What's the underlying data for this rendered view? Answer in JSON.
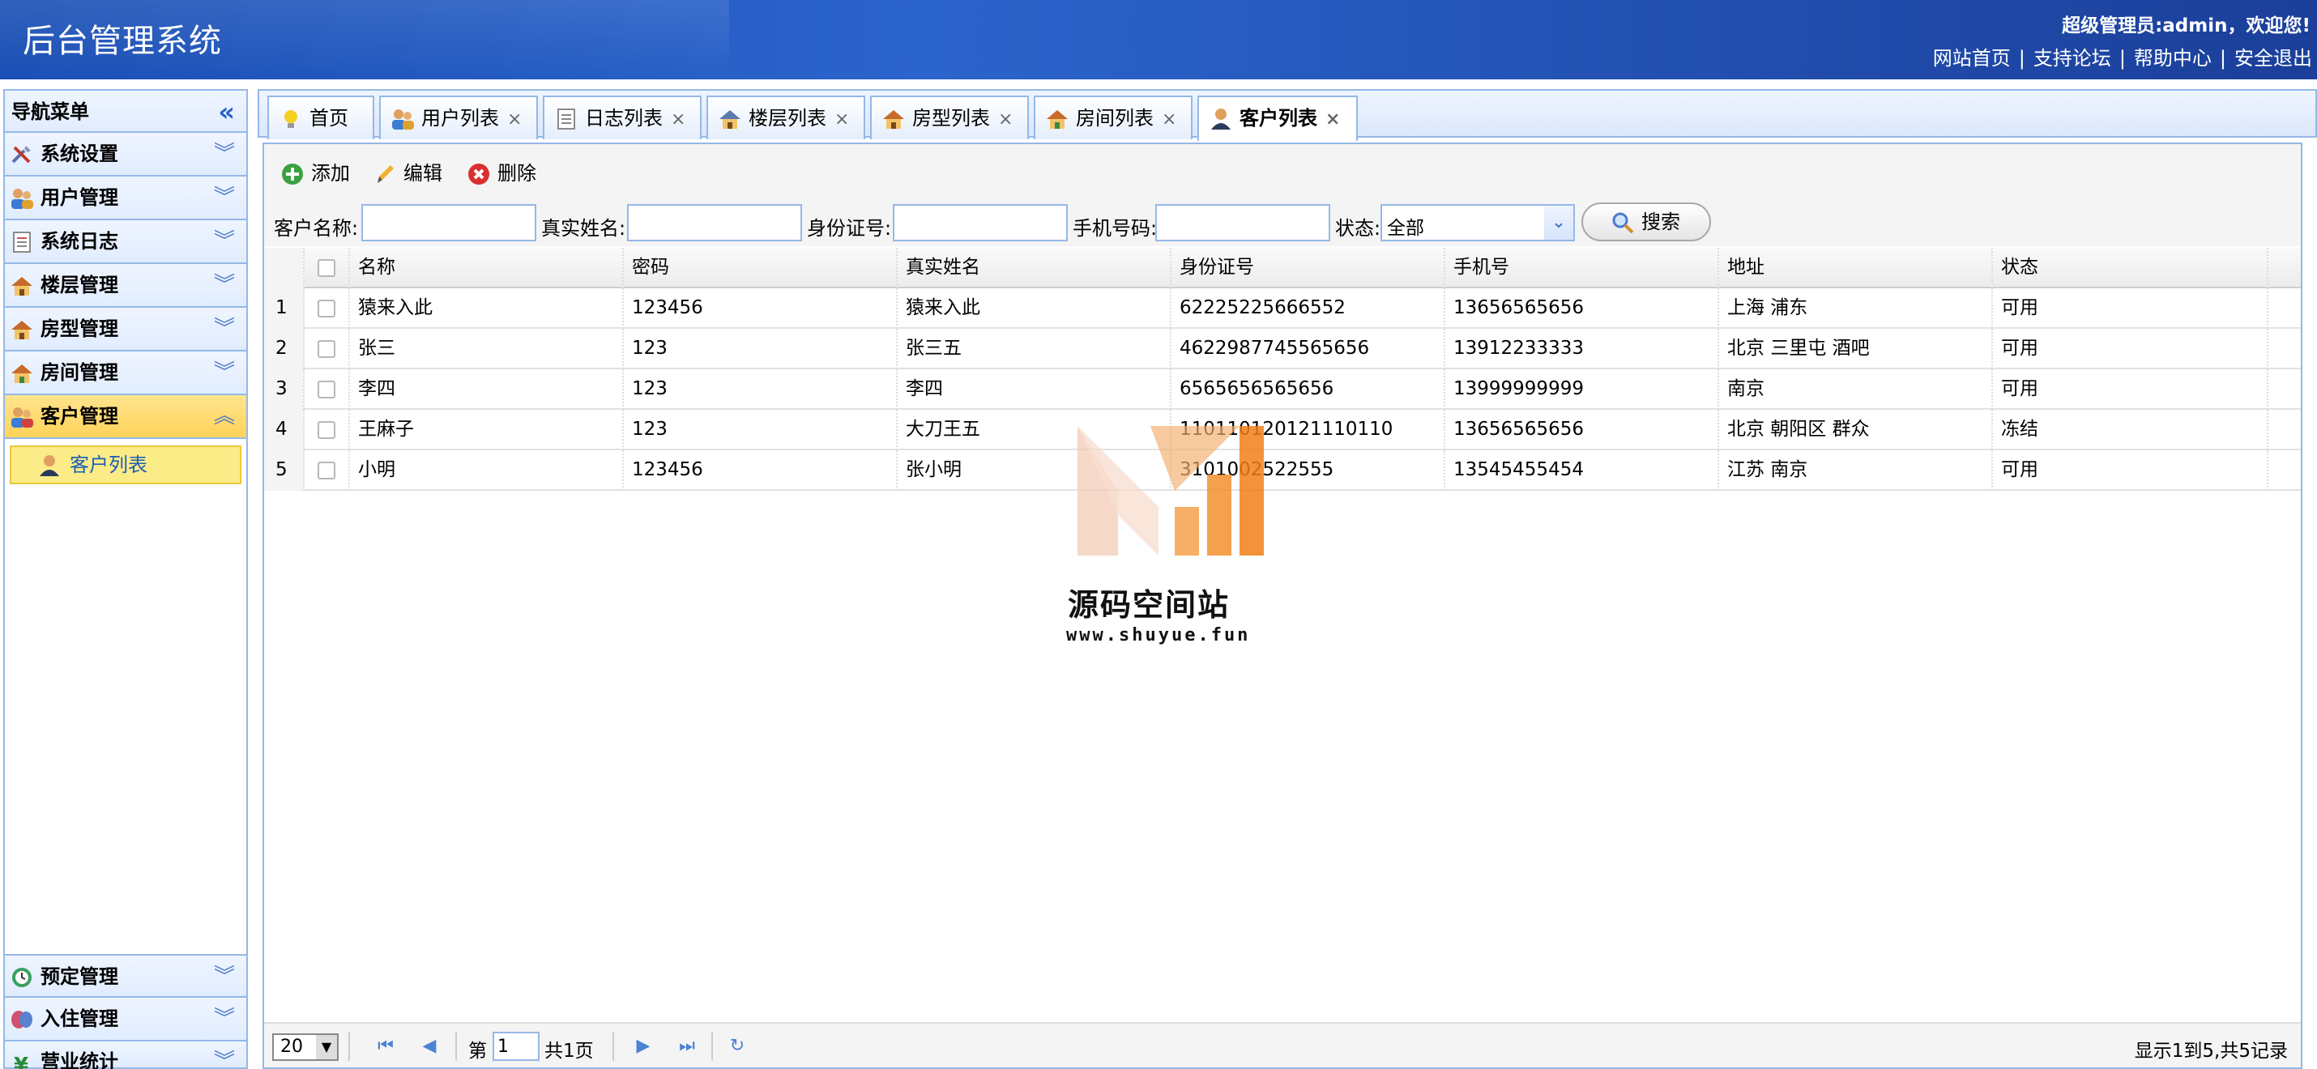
{
  "header": {
    "title": "后台管理系统",
    "welcome": "超级管理员:admin，欢迎您!",
    "links": [
      "网站首页",
      "支持论坛",
      "帮助中心",
      "安全退出"
    ]
  },
  "nav": {
    "title": "导航菜单",
    "items": [
      {
        "label": "系统设置",
        "icon": "tools-icon"
      },
      {
        "label": "用户管理",
        "icon": "users-icon"
      },
      {
        "label": "系统日志",
        "icon": "log-icon"
      },
      {
        "label": "楼层管理",
        "icon": "house-icon"
      },
      {
        "label": "房型管理",
        "icon": "house-icon"
      },
      {
        "label": "房间管理",
        "icon": "house-icon"
      },
      {
        "label": "客户管理",
        "icon": "customer-icon"
      }
    ],
    "active_sub": "客户列表",
    "bottom_items": [
      {
        "label": "预定管理",
        "icon": "clock-icon"
      },
      {
        "label": "入住管理",
        "icon": "checkin-icon"
      },
      {
        "label": "营业统计",
        "icon": "yen-icon"
      }
    ]
  },
  "tabs": [
    {
      "label": "首页",
      "closable": false
    },
    {
      "label": "用户列表",
      "closable": true
    },
    {
      "label": "日志列表",
      "closable": true
    },
    {
      "label": "楼层列表",
      "closable": true
    },
    {
      "label": "房型列表",
      "closable": true
    },
    {
      "label": "房间列表",
      "closable": true
    },
    {
      "label": "客户列表",
      "closable": true
    }
  ],
  "toolbar": {
    "add": "添加",
    "edit": "编辑",
    "delete": "删除"
  },
  "search": {
    "customer_name_label": "客户名称:",
    "real_name_label": "真实姓名:",
    "id_card_label": "身份证号:",
    "phone_label": "手机号码:",
    "status_label": "状态:",
    "status_value": "全部",
    "search_button": "搜索"
  },
  "table": {
    "columns": [
      "名称",
      "密码",
      "真实姓名",
      "身份证号",
      "手机号",
      "地址",
      "状态"
    ],
    "rows": [
      [
        "1",
        "猿来入此",
        "123456",
        "猿来入此",
        "62225225666552",
        "13656565656",
        "上海 浦东",
        "可用"
      ],
      [
        "2",
        "张三",
        "123",
        "张三五",
        "4622987745565656",
        "13912233333",
        "北京 三里屯 酒吧",
        "可用"
      ],
      [
        "3",
        "李四",
        "123",
        "李四",
        "6565656565656",
        "13999999999",
        "南京",
        "可用"
      ],
      [
        "4",
        "王麻子",
        "123",
        "大刀王五",
        "110110120121110110",
        "13656565656",
        "北京 朝阳区 群众",
        "冻结"
      ],
      [
        "5",
        "小明",
        "123456",
        "张小明",
        "3101002522555",
        "13545455454",
        "江苏 南京",
        "可用"
      ]
    ]
  },
  "watermark": {
    "title": "源码空间站",
    "url": "www.shuyue.fun"
  },
  "pager": {
    "page_size": "20",
    "page_prefix": "第",
    "page_value": "1",
    "page_total": "共1页",
    "info": "显示1到5,共5记录"
  },
  "colors": {
    "header_blue": "#2b64cc",
    "border_blue": "#95b8e7",
    "active_yellow": "#ffd35a"
  }
}
